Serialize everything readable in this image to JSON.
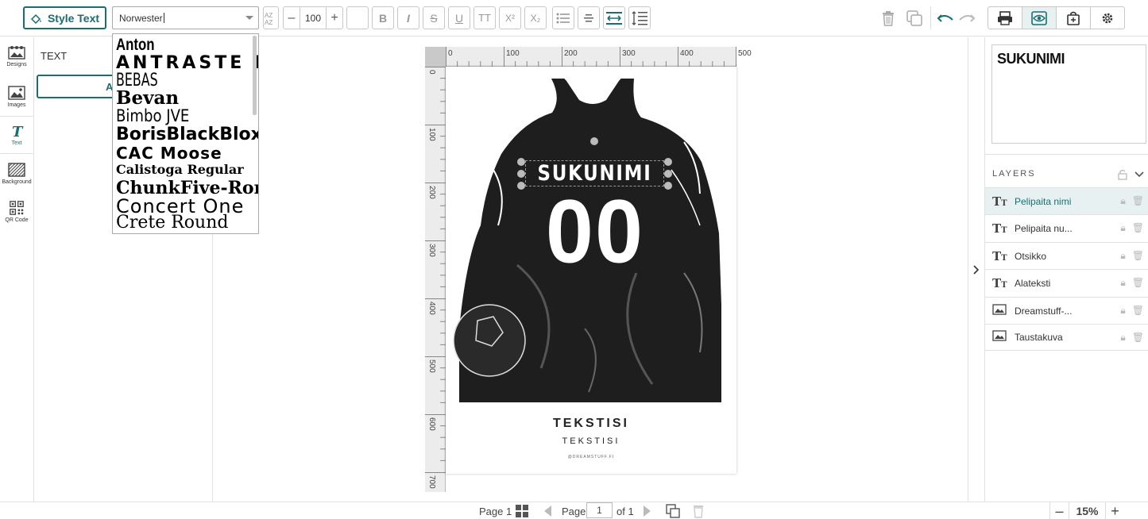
{
  "toolbar": {
    "style_text_label": "Style Text",
    "font_value": "Norwester",
    "font_size": "100",
    "minus": "–",
    "plus": "+",
    "bold": "B",
    "italic": "I",
    "strike": "S",
    "underline": "U",
    "caps": "TT",
    "superscript": "X²",
    "subscript": "X₂"
  },
  "rail": [
    {
      "label": "Designs",
      "icon": "designs-icon"
    },
    {
      "label": "Images",
      "icon": "images-icon"
    },
    {
      "label": "Text",
      "icon": "text-icon"
    },
    {
      "label": "Background",
      "icon": "background-icon"
    },
    {
      "label": "QR Code",
      "icon": "qr-code-icon"
    }
  ],
  "panel": {
    "title": "TEXT",
    "add_label": "Add a"
  },
  "font_list": [
    "Anton",
    "ANTRASTE REG",
    "BEBAS",
    "Bevan",
    "Bimbo JVE",
    "BorisBlackBloxx",
    "CAC Moose",
    "Calistoga Regular",
    "ChunkFive-Roman",
    "Concert One",
    "Crete Round"
  ],
  "rulers": {
    "h": [
      "0",
      "100",
      "200",
      "300",
      "400",
      "500"
    ],
    "v": [
      "0",
      "100",
      "200",
      "300",
      "400",
      "500",
      "600",
      "700"
    ]
  },
  "design": {
    "jersey_name": "SUKUNIMI",
    "jersey_number": "00",
    "title": "TEKSTISI",
    "subtitle": "TEKSTISI",
    "credit": "@DREAMSTUFF.FI"
  },
  "preview_text": "SUKUNIMI",
  "layers": {
    "title": "LAYERS",
    "items": [
      {
        "name": "Pelipaita nimi",
        "kind": "text",
        "selected": true
      },
      {
        "name": "Pelipaita nu...",
        "kind": "text",
        "selected": false
      },
      {
        "name": "Otsikko",
        "kind": "text",
        "selected": false
      },
      {
        "name": "Alateksti",
        "kind": "text",
        "selected": false
      },
      {
        "name": "Dreamstuff-...",
        "kind": "image",
        "selected": false
      },
      {
        "name": "Taustakuva",
        "kind": "image",
        "selected": false
      }
    ]
  },
  "bottom": {
    "page_label": "Page 1",
    "page_word": "Page",
    "page_value": "1",
    "of_label": "of 1",
    "zoom": "15%"
  },
  "colors": {
    "accent": "#1a6e72"
  }
}
